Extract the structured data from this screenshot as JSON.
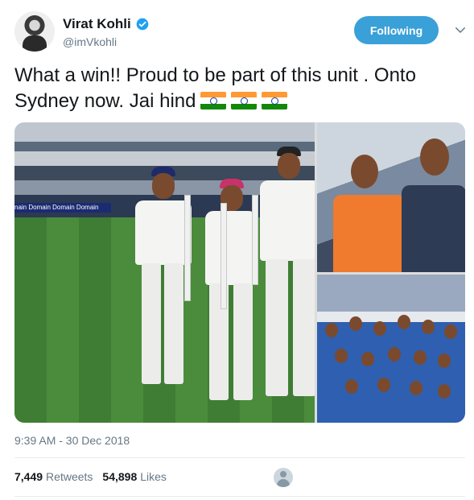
{
  "author": {
    "display_name": "Virat Kohli",
    "handle": "@imVkohli",
    "verified": true,
    "verified_icon": "verified-badge-icon",
    "follow_state_label": "Following"
  },
  "tweet": {
    "text": "What a win!! Proud to be part of this unit . Onto Sydney now. Jai hind",
    "emoji": [
      "india-flag-emoji",
      "india-flag-emoji",
      "india-flag-emoji"
    ],
    "timestamp": "9:39 AM - 30 Dec 2018"
  },
  "media": {
    "boards_text": "nain  Domain  Domain  Domain"
  },
  "stats": {
    "retweets_count": "7,449",
    "retweets_label": "Retweets",
    "likes_count": "54,898",
    "likes_label": "Likes"
  },
  "colors": {
    "follow_button": "#3aa0d8",
    "secondary_text": "#657786",
    "flag_saffron": "#ff9933",
    "flag_green": "#138808",
    "chakra_blue": "#0b3fa0"
  }
}
